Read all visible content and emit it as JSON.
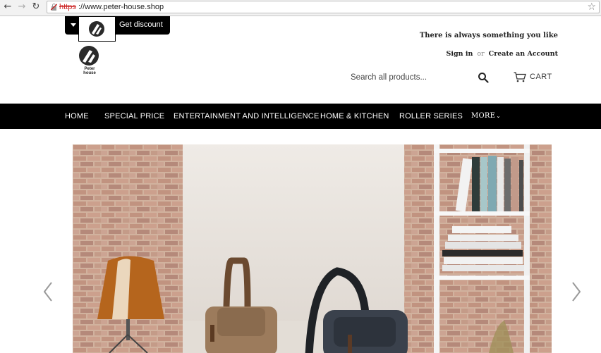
{
  "browser": {
    "url_scheme": "https",
    "url_rest": "://www.peter-house.shop",
    "back_icon": "back-arrow-icon",
    "forward_icon": "forward-arrow-icon",
    "reload_icon": "reload-icon",
    "bookmark_icon": "star-icon"
  },
  "header": {
    "discount_label": "Get discount",
    "logo_text": "Peter house",
    "tagline": "There is always something you like",
    "signin": "Sign in",
    "or": "or",
    "create_account": "Create an Account",
    "search_placeholder": "Search all products...",
    "cart_label": "CART"
  },
  "nav": {
    "items": [
      {
        "label": "HOME"
      },
      {
        "label": "SPECIAL PRICE"
      },
      {
        "label": "ENTERTAINMENT AND INTELLIGENCE"
      },
      {
        "label": "HOME & KITCHEN"
      },
      {
        "label": "ROLLER SERIES"
      },
      {
        "label": "MORE"
      }
    ]
  },
  "colors": {
    "nav_bg": "#000000",
    "nav_text": "#ffffff",
    "url_error": "#cc2222"
  }
}
